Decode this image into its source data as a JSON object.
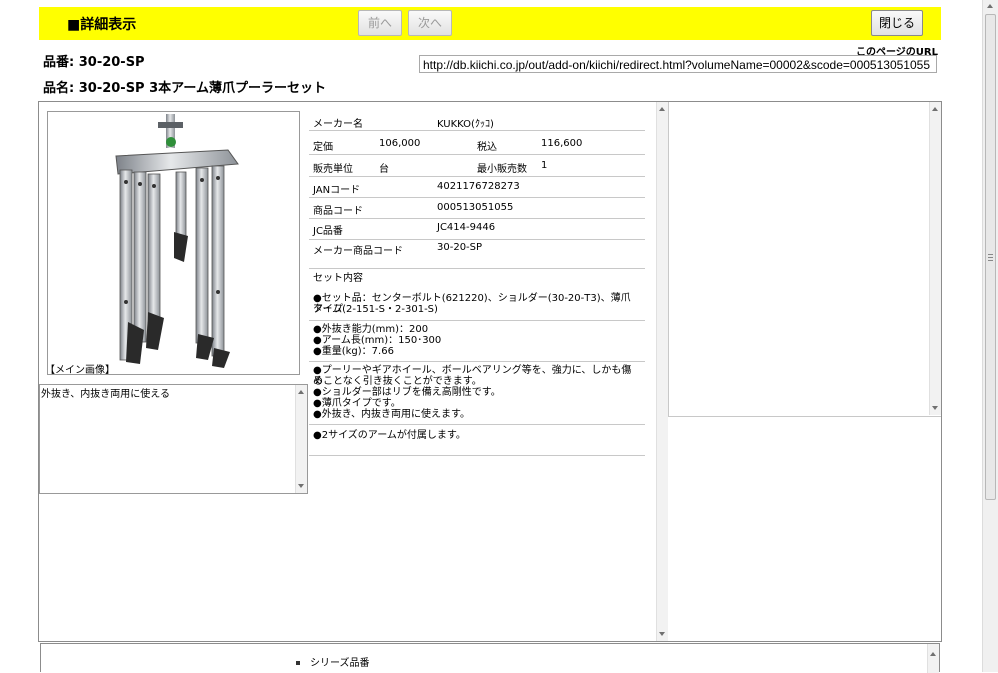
{
  "header": {
    "title": "■詳細表示",
    "prev_label": "前へ",
    "next_label": "次へ",
    "close_label": "閉じる"
  },
  "product": {
    "hinban": "品番: 30-20-SP",
    "hinmei": "品名: 30-20-SP 3本アーム薄爪プーラーセット"
  },
  "url": {
    "caption": "このページのURL",
    "value": "http://db.kiichi.co.jp/out/add-on/kiichi/redirect.html?volumeName=00002&scode=000513051055"
  },
  "image": {
    "caption": "【メイン画像】"
  },
  "description": "外抜き、内抜き両用に使える",
  "specs": {
    "maker_label": "メーカー名",
    "maker_value": "KUKKO(ｸｯｺ)",
    "price_label": "定価",
    "price_value": "106,000",
    "taxin_label": "税込",
    "taxin_value": "116,600",
    "unit_label": "販売単位",
    "unit_value": "台",
    "minqty_label": "最小販売数",
    "minqty_value": "1",
    "jan_label": "JANコード",
    "jan_value": "4021176728273",
    "code_label": "商品コード",
    "code_value": "000513051055",
    "jc_label": "JC品番",
    "jc_value": "JC414-9446",
    "makercode_label": "メーカー商品コード",
    "makercode_value": "30-20-SP",
    "set_title": "セット内容",
    "set_line1": "●セット品：センターボルト(621220)、ショルダー(30-20-T3)、薄爪タイプ",
    "set_line2": "アーム(2-151-S・2-301-S)",
    "spec_line1": "●外抜き能力(mm)：200",
    "spec_line2": "●アーム長(mm)：150･300",
    "spec_line3": "●重量(kg)：7.66",
    "feat_line1": "●プーリーやギアホイール、ボールベアリング等を、強力に、しかも傷め",
    "feat_line2": "ることなく引き抜くことができます。",
    "feat_line3": "●ショルダー部はリブを備え高剛性です。",
    "feat_line4": "●薄爪タイプです。",
    "feat_line5": "●外抜き、内抜き両用に使えます。",
    "arm_line": "●2サイズのアームが付属します。"
  },
  "series": {
    "label": "シリーズ品番"
  }
}
